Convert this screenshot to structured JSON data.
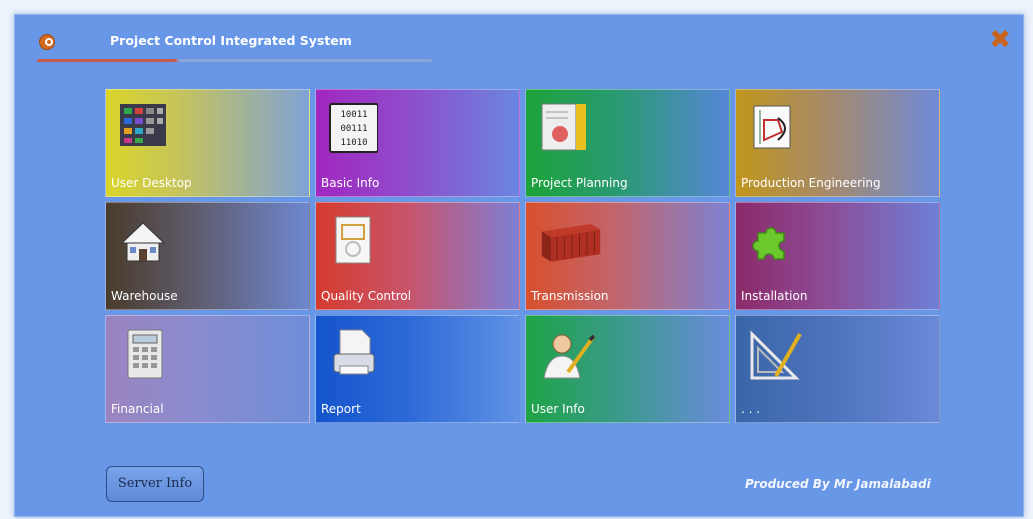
{
  "window": {
    "title": "Project Control Integrated System",
    "close_symbol": "✖"
  },
  "tiles": [
    {
      "label": "User Desktop",
      "icon": "desktop-apps-icon"
    },
    {
      "label": "Basic Info",
      "icon": "binary-data-icon"
    },
    {
      "label": "Project Planning",
      "icon": "planning-document-icon"
    },
    {
      "label": "Production Engineering",
      "icon": "engineering-drawing-icon"
    },
    {
      "label": "Warehouse",
      "icon": "house-icon"
    },
    {
      "label": "Quality Control",
      "icon": "quality-document-icon"
    },
    {
      "label": "Transmission",
      "icon": "shipping-container-icon"
    },
    {
      "label": "Installation",
      "icon": "puzzle-piece-icon"
    },
    {
      "label": "Financial",
      "icon": "calculator-icon"
    },
    {
      "label": "Report",
      "icon": "printer-icon"
    },
    {
      "label": "User Info",
      "icon": "user-pencil-icon"
    },
    {
      "label": ". . .",
      "icon": "drafting-tools-icon"
    }
  ],
  "footer": {
    "server_button": "Server Info",
    "credit": "Produced By Mr Jamalabadi"
  },
  "colors": {
    "window_bg": "#6797e6",
    "close_x": "#c8641e",
    "title_icon": "#d2691e"
  }
}
